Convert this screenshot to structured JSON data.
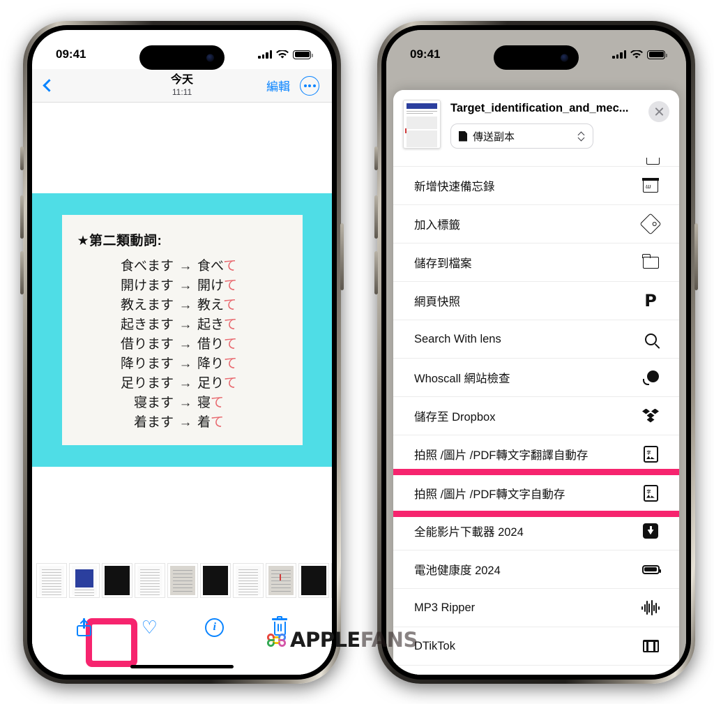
{
  "watermark": {
    "text_bold": "APPLE",
    "text_light": "FANS",
    "icon": "command-icon"
  },
  "left_phone": {
    "status": {
      "time": "09:41",
      "signal": "signal-bars-icon",
      "wifi": "wifi-icon",
      "battery": "battery-icon"
    },
    "nav": {
      "back": "back-chevron-icon",
      "title": "今天",
      "subtitle": "11:11",
      "edit_label": "編輯",
      "more": "more-ellipsis-icon"
    },
    "photo": {
      "heading": "★第二類動詞:",
      "live_text_button": "live-text-icon",
      "band_color": "#4fdde6",
      "card_color": "#f7f6f2",
      "verbs": [
        {
          "from": "食べます",
          "arrow": "→",
          "stem": "食べ",
          "te": "て"
        },
        {
          "from": "開けます",
          "arrow": "→",
          "stem": "開け",
          "te": "て"
        },
        {
          "from": "教えます",
          "arrow": "→",
          "stem": "教え",
          "te": "て"
        },
        {
          "from": "起きます",
          "arrow": "→",
          "stem": "起き",
          "te": "て"
        },
        {
          "from": "借ります",
          "arrow": "→",
          "stem": "借り",
          "te": "て"
        },
        {
          "from": "降ります",
          "arrow": "→",
          "stem": "降り",
          "te": "て"
        },
        {
          "from": "足ります",
          "arrow": "→",
          "stem": "足り",
          "te": "て"
        },
        {
          "from": "寝ます",
          "arrow": "→",
          "stem": "寝",
          "te": "て"
        },
        {
          "from": "着ます",
          "arrow": "→",
          "stem": "着",
          "te": "て"
        }
      ]
    },
    "thumbnails": [
      {
        "kind": "doc",
        "selected": false
      },
      {
        "kind": "blue-cover",
        "selected": false
      },
      {
        "kind": "dark",
        "selected": false
      },
      {
        "kind": "text",
        "selected": false
      },
      {
        "kind": "photo",
        "selected": false
      },
      {
        "kind": "dark",
        "selected": false
      },
      {
        "kind": "text",
        "selected": false
      },
      {
        "kind": "photo-red",
        "selected": false
      },
      {
        "kind": "dark",
        "selected": false
      },
      {
        "kind": "text",
        "selected": false
      },
      {
        "kind": "verbs",
        "selected": true
      },
      {
        "kind": "list",
        "selected": false
      },
      {
        "kind": "dark",
        "selected": false
      },
      {
        "kind": "doc",
        "selected": false
      }
    ],
    "toolbar": {
      "share_label": "share-icon",
      "favorite_label": "heart-icon",
      "info_label": "info-icon",
      "delete_label": "trash-icon",
      "share_highlight_color": "#f6246e"
    }
  },
  "right_phone": {
    "status": {
      "time": "09:41",
      "signal": "signal-bars-icon",
      "wifi": "wifi-icon",
      "battery": "battery-icon"
    },
    "share_sheet": {
      "doc_title": "Target_identification_and_mec...",
      "doc_thumbnail": "document-preview",
      "option_label": "傳送副本",
      "option_icon": "document-icon",
      "close_icon": "close-icon",
      "highlight_color": "#f6246e",
      "items": [
        {
          "label": "新增快速備忘錄",
          "icon": "quick-note-icon",
          "highlighted": false
        },
        {
          "label": "加入標籤",
          "icon": "tag-icon",
          "highlighted": false
        },
        {
          "label": "儲存到檔案",
          "icon": "folder-icon",
          "highlighted": false
        },
        {
          "label": "網頁快照",
          "icon": "pocket-icon",
          "highlighted": false
        },
        {
          "label": "Search With lens",
          "icon": "search-icon",
          "highlighted": false
        },
        {
          "label": "Whoscall 網站檢查",
          "icon": "whoscall-icon",
          "highlighted": false
        },
        {
          "label": "儲存至 Dropbox",
          "icon": "dropbox-icon",
          "highlighted": false
        },
        {
          "label": "拍照 /圖片 /PDF轉文字翻譯自動存",
          "icon": "ocr-icon",
          "highlighted": false
        },
        {
          "label": "拍照 /圖片 /PDF轉文字自動存",
          "icon": "ocr-icon",
          "highlighted": true
        },
        {
          "label": "全能影片下載器 2024",
          "icon": "download-icon",
          "highlighted": false
        },
        {
          "label": "電池健康度 2024",
          "icon": "battery-icon",
          "highlighted": false
        },
        {
          "label": "MP3 Ripper",
          "icon": "waveform-icon",
          "highlighted": false
        },
        {
          "label": "DTikTok",
          "icon": "film-icon",
          "highlighted": false
        }
      ]
    }
  }
}
